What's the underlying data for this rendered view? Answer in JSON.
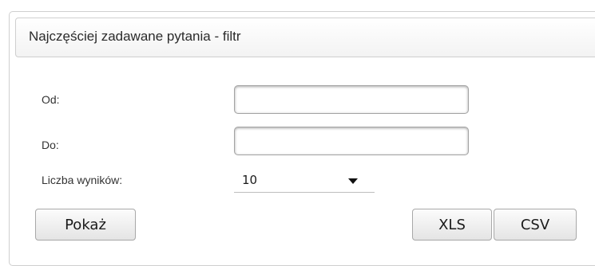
{
  "panel": {
    "title": "Najczęściej zadawane pytania - filtr"
  },
  "form": {
    "from_label": "Od:",
    "from_value": "",
    "to_label": "Do:",
    "to_value": "",
    "results_label": "Liczba wyników:",
    "results_value": "10"
  },
  "actions": {
    "show_label": "Pokaż",
    "xls_label": "XLS",
    "csv_label": "CSV"
  }
}
